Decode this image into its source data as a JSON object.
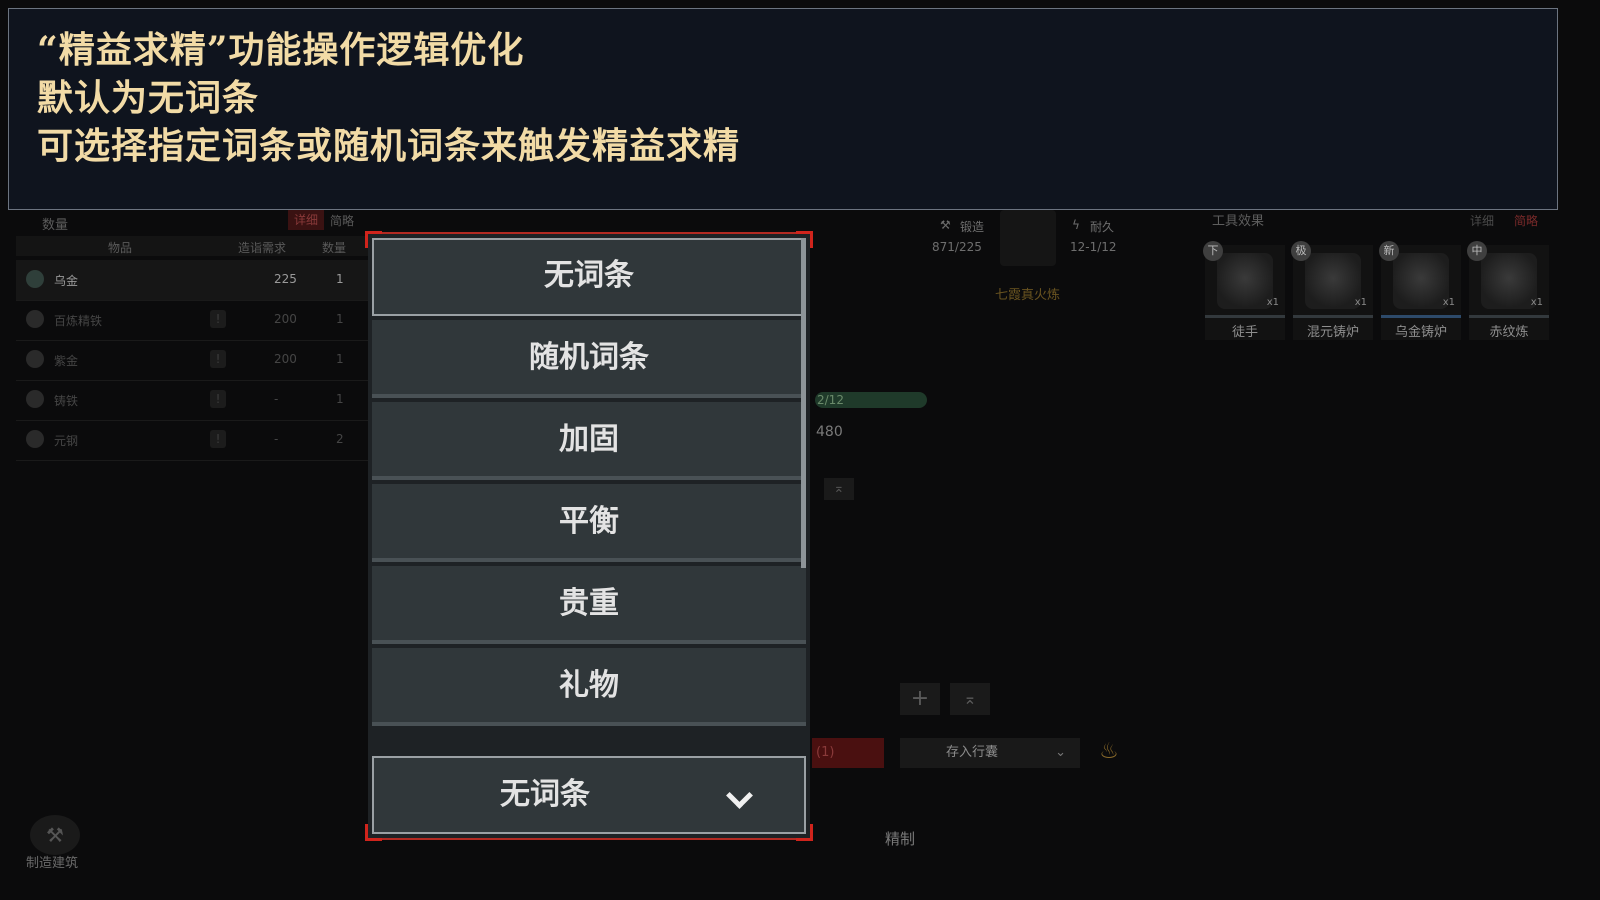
{
  "banner": {
    "line1": "“精益求精”功能操作逻辑优化",
    "line2": "默认为无词条",
    "line3": "可选择指定词条或随机词条来触发精益求精"
  },
  "left_panel": {
    "qty_label": "数量",
    "detail_label": "详细",
    "brief_label": "简略",
    "columns": [
      "物品",
      "造诣需求",
      "数量"
    ],
    "rows": [
      {
        "name": "乌金",
        "req": "225",
        "count": "1"
      },
      {
        "name": "百炼精铁",
        "req": "200",
        "count": "1"
      },
      {
        "name": "紫金",
        "req": "200",
        "count": "1"
      },
      {
        "name": "铸铁",
        "req": "-",
        "count": "1"
      },
      {
        "name": "元钢",
        "req": "-",
        "count": "2"
      }
    ]
  },
  "forge": {
    "forging_label": "锻造",
    "forging_value": "871/225",
    "durability_label": "耐久",
    "durability_value": "12-1/12",
    "recipe_name": "七霞真火炼"
  },
  "tools": {
    "title": "工具效果",
    "detail_label": "详细",
    "brief_label": "简略",
    "items": [
      {
        "name": "徒手",
        "badge": "下",
        "count": "x1"
      },
      {
        "name": "混元铸炉",
        "badge": "极",
        "count": "x1"
      },
      {
        "name": "乌金铸炉",
        "badge": "新",
        "count": "x1"
      },
      {
        "name": "赤纹炼",
        "badge": "中",
        "count": "x1"
      }
    ]
  },
  "center": {
    "progress_text": "2/12",
    "value_480": "480",
    "make_btn": "(1)",
    "store_select": "存入行囊",
    "refine_tab": "精制"
  },
  "bottom_left": {
    "build_label": "制造建筑"
  },
  "dropdown": {
    "options": [
      "无词条",
      "随机词条",
      "加固",
      "平衡",
      "贵重",
      "礼物"
    ],
    "current_value": "无词条"
  }
}
